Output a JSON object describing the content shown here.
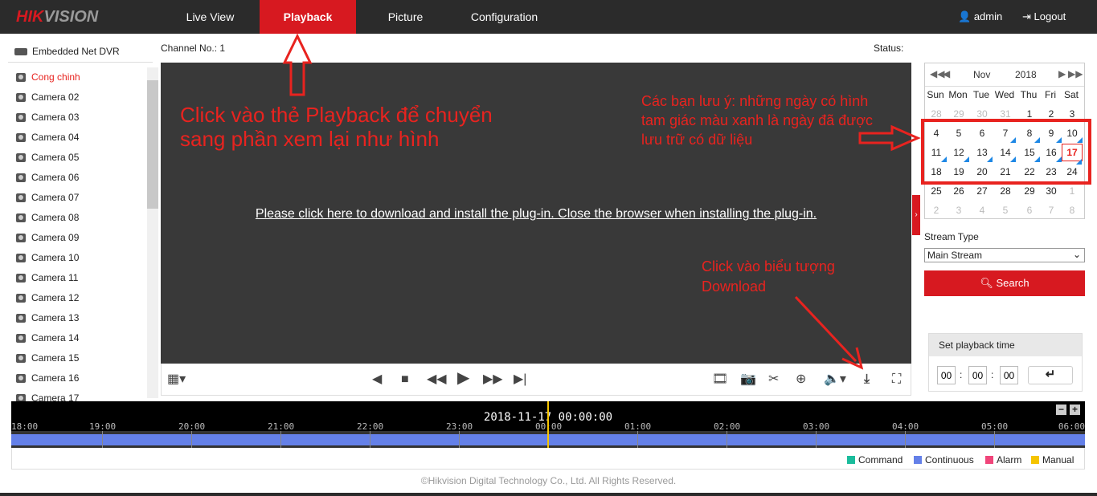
{
  "header": {
    "logo": "HIKVISION",
    "tabs": [
      "Live View",
      "Playback",
      "Picture",
      "Configuration"
    ],
    "active_tab": "Playback",
    "user": "admin",
    "logout": "Logout"
  },
  "sidebar": {
    "device": "Embedded Net DVR",
    "cameras": [
      "Cong chinh",
      "Camera 02",
      "Camera 03",
      "Camera 04",
      "Camera 05",
      "Camera 06",
      "Camera 07",
      "Camera 08",
      "Camera 09",
      "Camera 10",
      "Camera 11",
      "Camera 12",
      "Camera 13",
      "Camera 14",
      "Camera 15",
      "Camera 16",
      "Camera 17"
    ],
    "selected": "Cong chinh"
  },
  "main": {
    "channel": "Channel No.: 1",
    "status": "Status:",
    "plugin_link": "Please click here to download and install the plug-in. Close the browser when installing the plug-in."
  },
  "calendar": {
    "month": "Nov",
    "year": "2018",
    "weekdays": [
      "Sun",
      "Mon",
      "Tue",
      "Wed",
      "Thu",
      "Fri",
      "Sat"
    ],
    "days": [
      "28",
      "29",
      "30",
      "31",
      "1",
      "2",
      "3",
      "4",
      "5",
      "6",
      "7",
      "8",
      "9",
      "10",
      "11",
      "12",
      "13",
      "14",
      "15",
      "16",
      "17",
      "18",
      "19",
      "20",
      "21",
      "22",
      "23",
      "24",
      "25",
      "26",
      "27",
      "28",
      "29",
      "30",
      "1",
      "2",
      "3",
      "4",
      "5",
      "6",
      "7",
      "8"
    ],
    "other_month_indices": [
      0,
      1,
      2,
      3,
      34,
      35,
      36,
      37,
      38,
      39,
      40,
      41
    ],
    "recorded_days": [
      7,
      8,
      9,
      10,
      11,
      12,
      13,
      14,
      15,
      16,
      17
    ],
    "selected_day": 17
  },
  "search": {
    "stream_type_label": "Stream Type",
    "stream_type": "Main Stream",
    "search_button": "Search"
  },
  "playback_time": {
    "title": "Set playback time",
    "hh": "00",
    "mm": "00",
    "ss": "00"
  },
  "timeline": {
    "current": "2018-11-17 00:00:00",
    "labels": [
      "18:00",
      "19:00",
      "20:00",
      "21:00",
      "22:00",
      "23:00",
      "00:00",
      "01:00",
      "02:00",
      "03:00",
      "04:00",
      "05:00",
      "06:00"
    ]
  },
  "legend": [
    {
      "name": "Command",
      "color": "#1abc9c"
    },
    {
      "name": "Continuous",
      "color": "#6480e8"
    },
    {
      "name": "Alarm",
      "color": "#f0457a"
    },
    {
      "name": "Manual",
      "color": "#f5c400"
    }
  ],
  "annotations": {
    "playback": "Click vào thẻ Playback để chuyển sang phần xem lại như hình",
    "calendar": "Các bạn lưu ý: những ngày có hình tam giác màu xanh là ngày đã được lưu trữ có dữ liệu",
    "download": "Click vào biểu tượng Download"
  },
  "footer": "©Hikvision Digital Technology Co., Ltd. All Rights Reserved."
}
